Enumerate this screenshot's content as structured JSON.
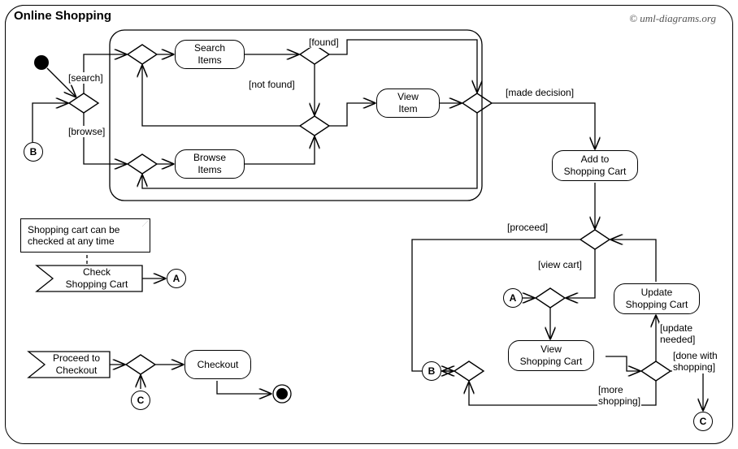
{
  "diagram": {
    "title": "Online Shopping",
    "copyright": "© uml-diagrams.org",
    "type": "UML Activity Diagram"
  },
  "activities": {
    "search_items": "Search\nItems",
    "browse_items": "Browse\nItems",
    "view_item": "View\nItem",
    "add_to_cart": "Add to\nShopping Cart",
    "update_cart": "Update\nShopping Cart",
    "view_cart": "View\nShopping Cart",
    "check_cart": "Check\nShopping Cart",
    "checkout": "Checkout",
    "proceed_checkout": "Proceed to\nCheckout"
  },
  "guards": {
    "search": "[search]",
    "browse": "[browse]",
    "found": "[found]",
    "not_found": "[not found]",
    "made_decision": "[made decision]",
    "proceed": "[proceed]",
    "view_cart": "[view cart]",
    "update_needed": "[update\nneeded]",
    "more_shopping": "[more\nshopping]",
    "done_shopping": "[done with\nshopping]"
  },
  "connectors": {
    "a": "A",
    "b": "B",
    "c": "C"
  },
  "notes": {
    "cart_anytime": "Shopping cart can be\nchecked at any time"
  }
}
